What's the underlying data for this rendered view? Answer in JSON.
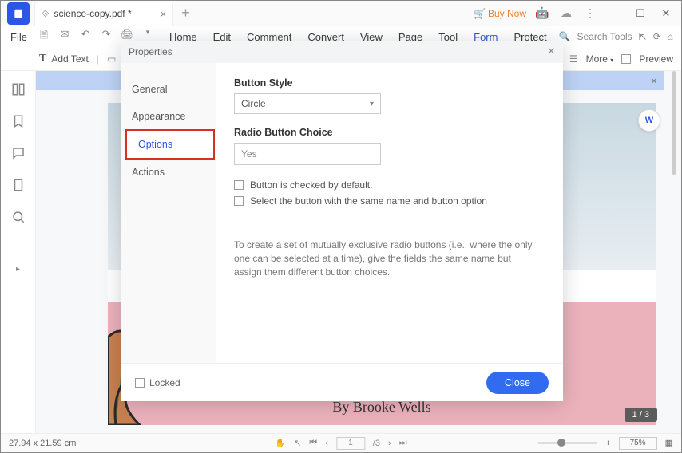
{
  "titlebar": {
    "tab_name": "science-copy.pdf *",
    "buy_now": "Buy Now"
  },
  "menubar": {
    "file": "File",
    "items": [
      "Home",
      "Edit",
      "Comment",
      "Convert",
      "View",
      "Page",
      "Tool",
      "Form",
      "Protect"
    ],
    "active_index": 7,
    "search_placeholder": "Search Tools"
  },
  "toolbar2": {
    "add_text": "Add Text",
    "more": "More",
    "preview": "Preview"
  },
  "preview": {
    "byline": "By Brooke Wells"
  },
  "modal": {
    "title": "Properties",
    "side": {
      "items": [
        "General",
        "Appearance",
        "Options",
        "Actions"
      ],
      "active_index": 2
    },
    "button_style_label": "Button Style",
    "button_style_value": "Circle",
    "radio_choice_label": "Radio Button Choice",
    "radio_choice_value": "Yes",
    "check1": "Button is checked by default.",
    "check2": "Select the button with the same name and button option",
    "hint": "To create a set of mutually exclusive radio buttons (i.e., where the only one can be selected at a time), give the fields the same name but assign them different button choices.",
    "locked": "Locked",
    "close": "Close"
  },
  "status": {
    "dims": "27.94 x 21.59 cm",
    "page_current": "1",
    "page_total": "3",
    "page_pill": "1 / 3",
    "zoom": "75%"
  }
}
